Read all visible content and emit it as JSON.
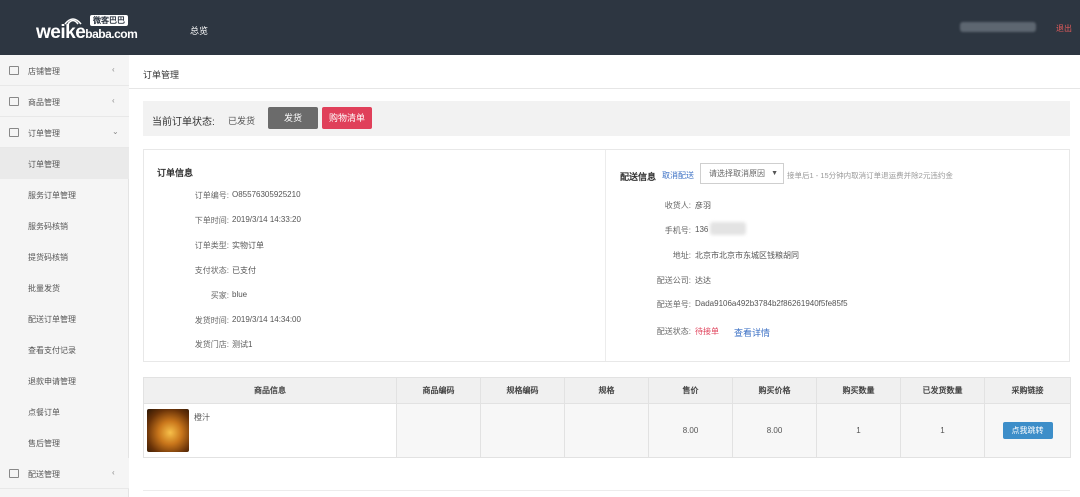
{
  "header": {
    "logo_text": "weike",
    "logo_suffix": "baba.com",
    "logo_badge": "微客巴巴",
    "nav_overview": "总览",
    "logout": "退出"
  },
  "sidebar": {
    "items": [
      {
        "label": "店铺管理",
        "type": "group",
        "chevron": "‹",
        "icon": "store-icon"
      },
      {
        "label": "商品管理",
        "type": "group",
        "chevron": "‹",
        "icon": "goods-icon"
      },
      {
        "label": "订单管理",
        "type": "group",
        "chevron": "⌄",
        "icon": "order-icon"
      },
      {
        "label": "订单管理",
        "type": "sub",
        "active": true
      },
      {
        "label": "服务订单管理",
        "type": "sub"
      },
      {
        "label": "服务码核销",
        "type": "sub"
      },
      {
        "label": "提货码核销",
        "type": "sub"
      },
      {
        "label": "批量发货",
        "type": "sub"
      },
      {
        "label": "配送订单管理",
        "type": "sub"
      },
      {
        "label": "查看支付记录",
        "type": "sub"
      },
      {
        "label": "退款申请管理",
        "type": "sub"
      },
      {
        "label": "点餐订单",
        "type": "sub"
      },
      {
        "label": "售后管理",
        "type": "sub"
      },
      {
        "label": "配送管理",
        "type": "group",
        "chevron": "‹",
        "icon": "delivery-icon"
      }
    ]
  },
  "page": {
    "title": "订单管理",
    "status_label": "当前订单状态:",
    "status_value": "已发货",
    "ship_button": "发货",
    "cart_button": "购物清单"
  },
  "order_info": {
    "heading": "订单信息",
    "rows": [
      {
        "key": "订单编号:",
        "value": "O85576305925210"
      },
      {
        "key": "下单时间:",
        "value": "2019/3/14 14:33:20"
      },
      {
        "key": "订单类型:",
        "value": "实物订单"
      },
      {
        "key": "支付状态:",
        "value": "已支付"
      },
      {
        "key": "买家:",
        "value": "blue"
      },
      {
        "key": "发货时间:",
        "value": "2019/3/14 14:34:00"
      },
      {
        "key": "发货门店:",
        "value": "测试1"
      }
    ]
  },
  "delivery_info": {
    "heading": "配送信息",
    "cancel_link": "取消配送",
    "cancel_reason_placeholder": "请选择取消原因",
    "hint": "接单后1 - 15分钟内取消订单退运费并除2元违约金",
    "rows": [
      {
        "key": "收货人:",
        "value": "彦羽"
      },
      {
        "key": "手机号:",
        "value": "136"
      },
      {
        "key": "地址:",
        "value": "北京市北京市东城区钱粮胡同"
      },
      {
        "key": "配送公司:",
        "value": "达达"
      },
      {
        "key": "配送单号:",
        "value": "Dada9106a492b3784b2f86261940f5fe85f5"
      },
      {
        "key": "配送状态:",
        "value": "待接单"
      }
    ],
    "detail_link": "查看详情"
  },
  "goods_table": {
    "columns": [
      "商品信息",
      "商品编码",
      "规格编码",
      "规格",
      "售价",
      "购买价格",
      "购买数量",
      "已发货数量",
      "采购链接"
    ],
    "rows": [
      {
        "name": "橙汁",
        "code": "",
        "spec_code": "",
        "spec": "",
        "price": "8.00",
        "buy_price": "8.00",
        "qty": "1",
        "shipped": "1",
        "action": "点我跳转"
      }
    ]
  }
}
